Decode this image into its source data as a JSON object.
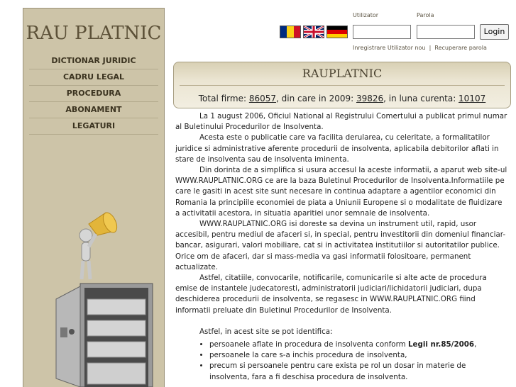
{
  "logo": "RAU PLATNIC",
  "nav": [
    "DICTIONAR JURIDIC",
    "CADRU LEGAL",
    "PROCEDURA",
    "ABONAMENT",
    "LEGATURI"
  ],
  "login": {
    "user_label": "Utilizator",
    "pass_label": "Parola",
    "user_value": "",
    "pass_value": "",
    "button": "Login",
    "register": "Inregistrare Utilizator nou",
    "separator": "|",
    "recover": "Recuperare parola"
  },
  "flags": [
    "romania-flag-icon",
    "uk-flag-icon",
    "germany-flag-icon"
  ],
  "panel": {
    "title": "RAUPLATNIC",
    "stats_prefix": "Total firme: ",
    "total": "86057",
    "stats_mid1": ", din care in 2009: ",
    "y2009": "39826",
    "stats_mid2": ", in luna curenta: ",
    "month": "10107"
  },
  "paragraphs": [
    "La 1 august 2006, Oficiul National al Registrului Comertului a publicat primul numar al Buletinului Procedurilor de Insolventa.",
    "Acesta este o publicatie care va facilita derularea, cu celeritate, a formalitatilor juridice si administrative aferente procedurii de insolventa, aplicabila debitorilor aflati in stare de insolventa sau de insolventa iminenta.",
    "Din dorinta de a simplifica si usura accesul la aceste informatii, a aparut web site-ul WWW.RAUPLATNIC.ORG ce are la baza Buletinul Procedurilor de Insolventa.Informatiile pe care le gasiti in acest site sunt necesare in continua adaptare a agentilor economici din Romania la principiile economiei de piata a Uniunii Europene si o modalitate de fluidizare a activitatii acestora, in situatia aparitiei unor semnale de insolventa.",
    "WWW.RAUPLATNIC.ORG isi doreste sa devina un instrument util, rapid, usor accesibil, pentru mediul de afaceri si, in special, pentru investitorii din domeniul financiar-bancar, asigurari, valori mobiliare, cat si in activitatea institutiilor si autoritatilor publice. Orice om de afaceri, dar si mass-media va gasi informatii folositoare, permanent actualizate.",
    "Astfel, citatiile, convocarile, notificarile, comunicarile si alte acte de procedura emise de instantele judecatoresti, administratorii judiciari/lichidatorii judiciari, dupa deschiderea procedurii de insolventa, se regasesc in WWW.RAUPLATNIC.ORG fiind informatii preluate din Buletinul Procedurilor de Insolventa."
  ],
  "identify_intro": "Astfel, in acest site se pot identifica:",
  "bullets": {
    "b1_prefix": "persoanele aflate in procedura de insolventa conform ",
    "b1_link": "Legii nr.85/2006",
    "b1_suffix": ",",
    "b2": "persoanele la care s-a inchis procedura de insolventa,",
    "b3": "precum si persoanele pentru care exista pe rol un dosar in materie de insolventa, fara a fi deschisa procedura de insolventa."
  }
}
